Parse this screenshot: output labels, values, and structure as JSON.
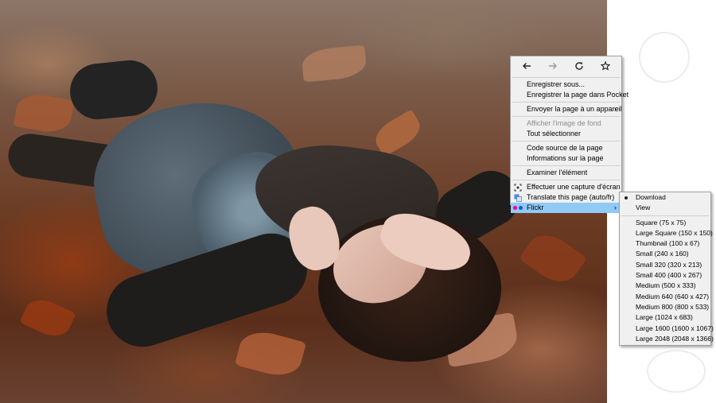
{
  "nav": {
    "back": "back-icon",
    "forward": "forward-icon",
    "reload": "reload-icon",
    "bookmark": "star-icon"
  },
  "context_menu": {
    "groups": [
      [
        {
          "label": "Enregistrer sous..."
        },
        {
          "label": "Enregistrer la page dans Pocket"
        }
      ],
      [
        {
          "label": "Envoyer la page à un appareil",
          "submenu": true
        }
      ],
      [
        {
          "label": "Afficher l'image de fond",
          "disabled": true
        },
        {
          "label": "Tout sélectionner"
        }
      ],
      [
        {
          "label": "Code source de la page"
        },
        {
          "label": "Informations sur la page"
        }
      ],
      [
        {
          "label": "Examiner l'élément"
        }
      ],
      [
        {
          "label": "Effectuer une capture d'écran",
          "icon": "screenshot-icon"
        },
        {
          "label": "Translate this page (auto/fr)",
          "icon": "translate-icon"
        },
        {
          "label": "Flickr",
          "icon": "flickr-icon",
          "submenu": true,
          "highlighted": true
        }
      ]
    ],
    "submenu_arrow": "›"
  },
  "flickr_submenu": {
    "top_items": [
      {
        "label": "Download",
        "selected": true
      },
      {
        "label": "View"
      }
    ],
    "sizes": [
      "Square (75 x 75)",
      "Large Square (150 x 150)",
      "Thumbnail (100 x 67)",
      "Small (240 x 160)",
      "Small 320 (320 x 213)",
      "Small 400 (400 x 267)",
      "Medium (500 x 333)",
      "Medium 640 (640 x 427)",
      "Medium 800 (800 x 533)",
      "Large (1024 x 683)",
      "Large 1600 (1600 x 1067)",
      "Large 2048 (2048 x 1366)"
    ]
  },
  "colors": {
    "menu_bg": "#f0f0f0",
    "highlight": "#91c9f7",
    "flickr_pink": "#ff0084",
    "flickr_blue": "#0063dc"
  }
}
